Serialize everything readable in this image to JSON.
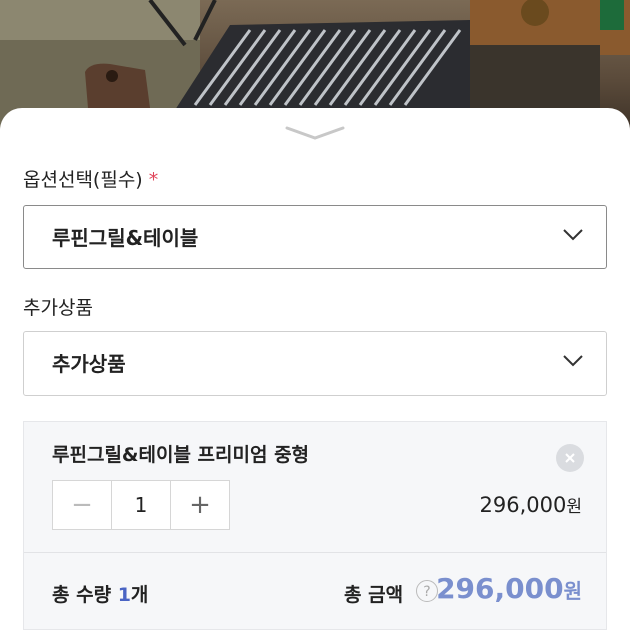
{
  "option": {
    "label": "옵션선택(필수)",
    "required_mark": "*",
    "selected": "루핀그릴&테이블"
  },
  "addon": {
    "label": "추가상품",
    "selected": "추가상품"
  },
  "selected_item": {
    "name": "루핀그릴&테이블 프리미엄 중형",
    "minus": "−",
    "quantity": "1",
    "plus": "+",
    "price": "296,000",
    "price_unit": "원"
  },
  "summary": {
    "total_qty_label": "총 수량",
    "total_qty_value": "1",
    "total_qty_unit": "개",
    "total_amount_label": "총 금액",
    "help": "?",
    "total_amount": "296,000",
    "total_amount_unit": "원"
  },
  "colors": {
    "accent_blue": "#7a8fce",
    "required_red": "#e0455a"
  }
}
